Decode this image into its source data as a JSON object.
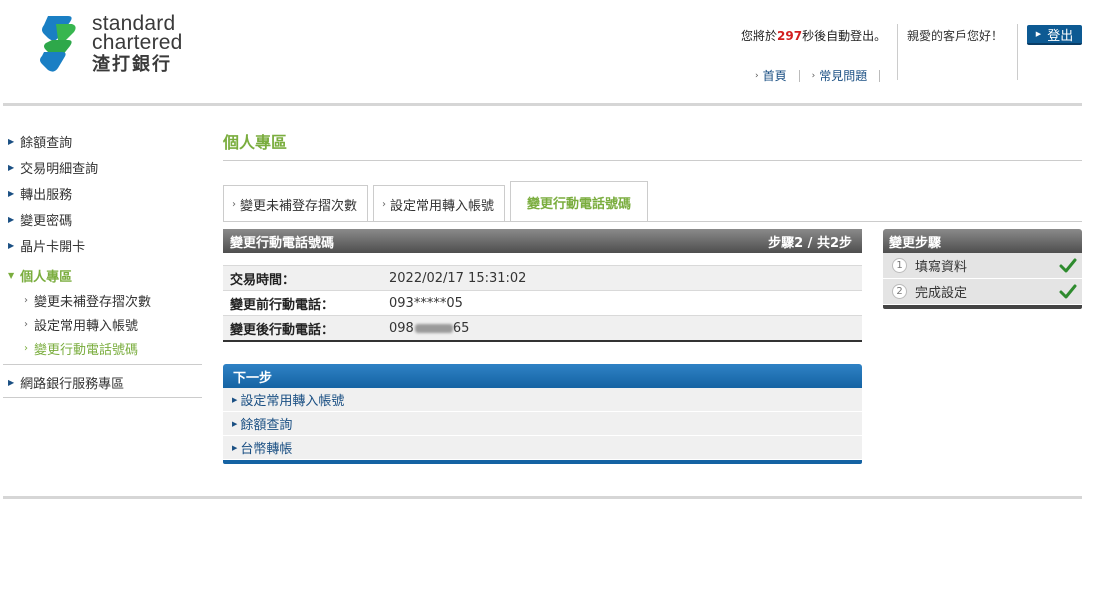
{
  "header": {
    "logo_en_line1": "standard",
    "logo_en_line2": "chartered",
    "logo_zh": "渣打銀行",
    "session_prefix": "您將於",
    "session_seconds": "297",
    "session_suffix": "秒後自動登出。",
    "greeting": "親愛的客戶您好！",
    "logout_label": "登出",
    "links": [
      "首頁",
      "常見問題"
    ]
  },
  "sidebar": {
    "items": [
      {
        "label": "餘額查詢"
      },
      {
        "label": "交易明細查詢"
      },
      {
        "label": "轉出服務"
      },
      {
        "label": "變更密碼"
      },
      {
        "label": "晶片卡開卡"
      }
    ],
    "active_section": "個人專區",
    "sub_items": [
      {
        "label": "變更未補登存摺次數"
      },
      {
        "label": "設定常用轉入帳號"
      },
      {
        "label": "變更行動電話號碼"
      }
    ],
    "bottom_item": "網路銀行服務專區"
  },
  "main": {
    "page_title": "個人專區",
    "tabs": [
      {
        "label": "變更未補登存摺次數"
      },
      {
        "label": "設定常用轉入帳號"
      },
      {
        "label": "變更行動電話號碼"
      }
    ],
    "panel": {
      "title": "變更行動電話號碼",
      "step_text": "步驟2 / 共2步",
      "rows": [
        {
          "label": "交易時間：",
          "value": "2022/02/17 15:31:02"
        },
        {
          "label": "變更前行動電話：",
          "value": "093*****05"
        },
        {
          "label": "變更後行動電話：",
          "value_prefix": "098",
          "value_suffix": "65"
        }
      ]
    },
    "next_steps": {
      "title": "下一步",
      "items": [
        {
          "label": "設定常用轉入帳號"
        },
        {
          "label": "餘額查詢"
        },
        {
          "label": "台幣轉帳"
        }
      ]
    }
  },
  "steps_box": {
    "title": "變更步驟",
    "steps": [
      {
        "num": "1",
        "label": "填寫資料"
      },
      {
        "num": "2",
        "label": "完成設定"
      }
    ]
  },
  "colors": {
    "accent_green": "#7aad3e",
    "brand_blue": "#0d5a93",
    "warning_red": "#d21f1f"
  }
}
